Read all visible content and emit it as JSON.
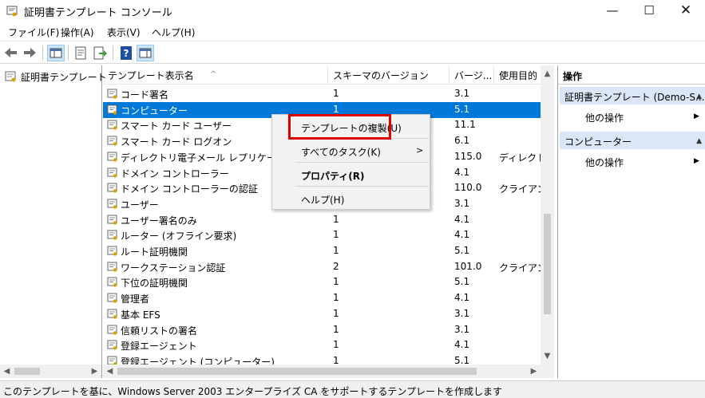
{
  "window": {
    "title": "証明書テンプレート コンソール",
    "minimize": "—",
    "maximize": "☐",
    "close": "✕"
  },
  "menubar": [
    "ファイル(F)",
    "操作(A)",
    "表示(V)",
    "ヘルプ(H)"
  ],
  "tree": {
    "root_label": "証明書テンプレート"
  },
  "list": {
    "columns": [
      "テンプレート表示名",
      "スキーマのバージョン",
      "バージ...",
      "使用目的"
    ],
    "rows": [
      {
        "name": "コード署名",
        "schema": "1",
        "version": "3.1",
        "purpose": ""
      },
      {
        "name": "コンピューター",
        "schema": "1",
        "version": "5.1",
        "purpose": ""
      },
      {
        "name": "スマート カード ユーザー",
        "schema": "",
        "version": "11.1",
        "purpose": ""
      },
      {
        "name": "スマート カード ログオン",
        "schema": "",
        "version": "6.1",
        "purpose": ""
      },
      {
        "name": "ディレクトリ電子メール レプリケーション",
        "schema": "",
        "version": "115.0",
        "purpose": "ディレクトリ"
      },
      {
        "name": "ドメイン コントローラー",
        "schema": "",
        "version": "4.1",
        "purpose": ""
      },
      {
        "name": "ドメイン コントローラーの認証",
        "schema": "",
        "version": "110.0",
        "purpose": "クライアント"
      },
      {
        "name": "ユーザー",
        "schema": "",
        "version": "3.1",
        "purpose": ""
      },
      {
        "name": "ユーザー署名のみ",
        "schema": "1",
        "version": "4.1",
        "purpose": ""
      },
      {
        "name": "ルーター (オフライン要求)",
        "schema": "1",
        "version": "4.1",
        "purpose": ""
      },
      {
        "name": "ルート証明機関",
        "schema": "1",
        "version": "5.1",
        "purpose": ""
      },
      {
        "name": "ワークステーション認証",
        "schema": "2",
        "version": "101.0",
        "purpose": "クライアント"
      },
      {
        "name": "下位の証明機関",
        "schema": "1",
        "version": "5.1",
        "purpose": ""
      },
      {
        "name": "管理者",
        "schema": "1",
        "version": "4.1",
        "purpose": ""
      },
      {
        "name": "基本 EFS",
        "schema": "1",
        "version": "3.1",
        "purpose": ""
      },
      {
        "name": "信頼リストの署名",
        "schema": "1",
        "version": "3.1",
        "purpose": ""
      },
      {
        "name": "登録エージェント",
        "schema": "1",
        "version": "4.1",
        "purpose": ""
      },
      {
        "name": "登録エージェント (コンピューター)",
        "schema": "1",
        "version": "5.1",
        "purpose": ""
      }
    ],
    "selected_index": 1
  },
  "context_menu": {
    "items": [
      "テンプレートの複製(U)",
      "すべてのタスク(K)",
      "プロパティ(R)",
      "ヘルプ(H)"
    ],
    "submenu_arrow": ">"
  },
  "actions": {
    "title": "操作",
    "section1": "証明書テンプレート (Demo-S...",
    "section1_link": "他の操作",
    "section2": "コンピューター",
    "section2_link": "他の操作"
  },
  "status": "このテンプレートを基に、Windows Server 2003 エンタープライズ CA をサポートするテンプレートを作成します",
  "colors": {
    "selection": "#0078d7",
    "highlight_box": "#e00000",
    "section_bg": "#dbe7f6"
  }
}
